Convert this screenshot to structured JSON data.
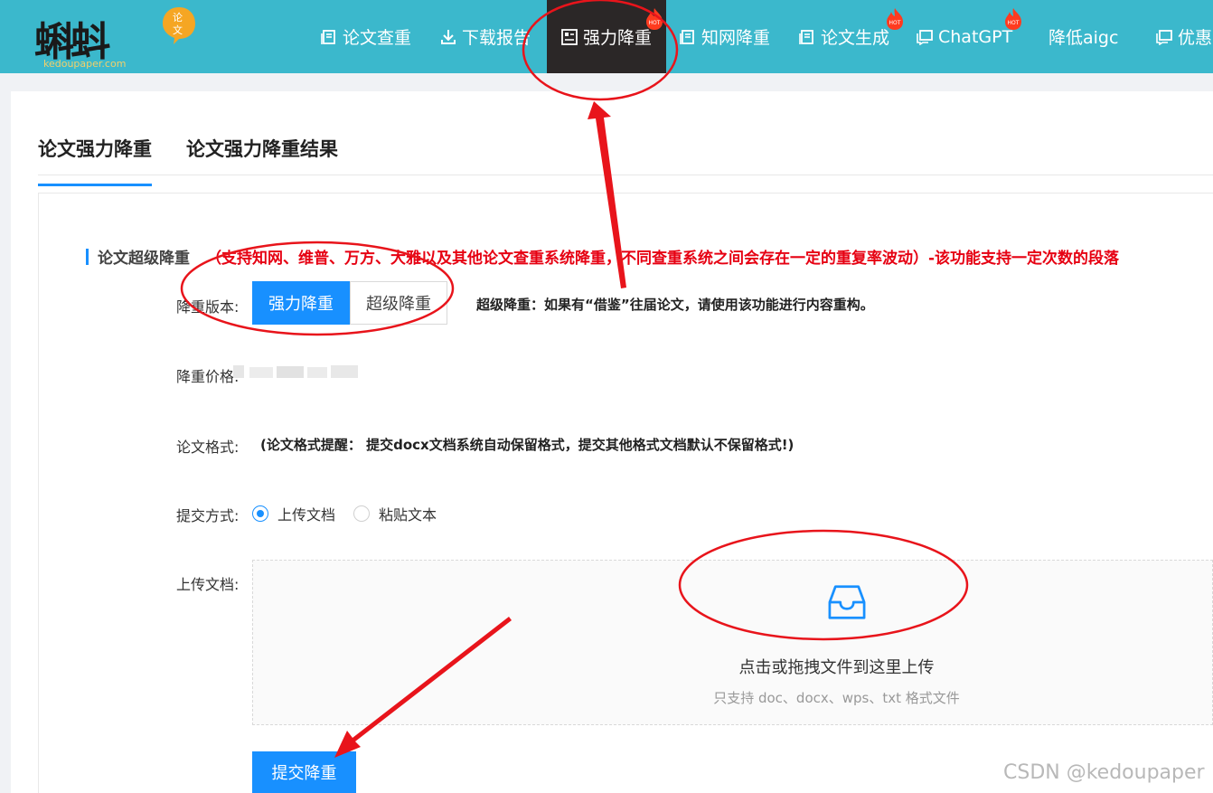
{
  "logo": {
    "main": "蝌蚪",
    "sub": "kedoupaper.com",
    "badge": "论文"
  },
  "nav": {
    "items": [
      {
        "label": "论文查重",
        "icon": "document-icon",
        "hot": false
      },
      {
        "label": "下载报告",
        "icon": "download-icon",
        "hot": false
      },
      {
        "label": "强力降重",
        "icon": "grid-icon",
        "hot": true,
        "active": true
      },
      {
        "label": "知网降重",
        "icon": "document-icon",
        "hot": false
      },
      {
        "label": "论文生成",
        "icon": "document-icon",
        "hot": true
      },
      {
        "label": "ChatGPT",
        "icon": "chat-icon",
        "hot": true
      },
      {
        "label": "降低aigc",
        "icon": "",
        "hot": false
      },
      {
        "label": "优惠",
        "icon": "chat-icon",
        "hot": false
      }
    ],
    "hot_text": "HOT"
  },
  "tabs": [
    {
      "label": "论文强力降重",
      "active": true
    },
    {
      "label": "论文强力降重结果",
      "active": false
    }
  ],
  "section": {
    "title": "论文超级降重",
    "notice": "（支持知网、维普、万方、大雅以及其他论文查重系统降重，不同查重系统之间会存在一定的重复率波动）-该功能支持一定次数的段落"
  },
  "form": {
    "version_label": "降重版本:",
    "version_options": [
      "强力降重",
      "超级降重"
    ],
    "version_selected": "强力降重",
    "version_note": "超级降重：如果有“借鉴”往届论文，请使用该功能进行内容重构。",
    "price_label": "降重价格:",
    "format_label": "论文格式:",
    "format_note": "(论文格式提醒： 提交docx文档系统自动保留格式，提交其他格式文档默认不保留格式!)",
    "submit_method_label": "提交方式:",
    "submit_methods": [
      "上传文档",
      "粘贴文本"
    ],
    "submit_method_selected": "上传文档",
    "upload_label": "上传文档:",
    "upload_title": "点击或拖拽文件到这里上传",
    "upload_hint": "只支持 doc、docx、wps、txt 格式文件",
    "submit_button": "提交降重"
  },
  "watermark": "CSDN @kedoupaper",
  "colors": {
    "topbar": "#3bb8cc",
    "nav_active": "#2b2727",
    "primary": "#1890ff",
    "notice_red": "#e60012",
    "annotation_red": "#e8141b"
  }
}
